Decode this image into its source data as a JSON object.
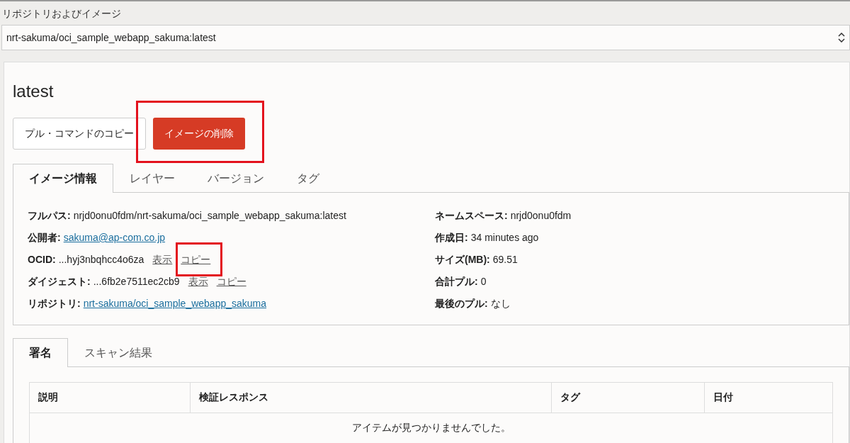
{
  "repo_select": {
    "label": "リポジトリおよびイメージ",
    "value": "nrt-sakuma/oci_sample_webapp_sakuma:latest"
  },
  "title": "latest",
  "actions": [
    {
      "label": "プル・コマンドのコピー",
      "kind": "secondary",
      "highlighted": false
    },
    {
      "label": "イメージの削除",
      "kind": "danger",
      "highlighted": true
    }
  ],
  "tabs": [
    {
      "label": "イメージ情報",
      "selected": true
    },
    {
      "label": "レイヤー",
      "selected": false
    },
    {
      "label": "バージョン",
      "selected": false
    },
    {
      "label": "タグ",
      "selected": false
    }
  ],
  "details_left": [
    {
      "label": "フルパス:",
      "value": "nrjd0onu0fdm/nrt-sakuma/oci_sample_webapp_sakuma:latest",
      "kind": "text"
    },
    {
      "label": "公開者:",
      "value": "sakuma@ap-com.co.jp",
      "kind": "link"
    },
    {
      "label": "OCID:",
      "value": "...hyj3nbqhcc4o6za",
      "kind": "text",
      "actions": [
        {
          "label": "表示",
          "highlighted": false
        },
        {
          "label": "コピー",
          "highlighted": true
        }
      ]
    },
    {
      "label": "ダイジェスト:",
      "value": "...6fb2e7511ec2cb9",
      "kind": "text",
      "actions": [
        {
          "label": "表示",
          "highlighted": false
        },
        {
          "label": "コピー",
          "highlighted": false
        }
      ]
    },
    {
      "label": "リポジトリ:",
      "value": "nrt-sakuma/oci_sample_webapp_sakuma",
      "kind": "link"
    }
  ],
  "details_right": [
    {
      "label": "ネームスペース:",
      "value": "nrjd0onu0fdm"
    },
    {
      "label": "作成日:",
      "value": "34 minutes ago"
    },
    {
      "label": "サイズ(MB):",
      "value": "69.51"
    },
    {
      "label": "合計プル:",
      "value": "0"
    },
    {
      "label": "最後のプル:",
      "value": "なし"
    }
  ],
  "lower_tabs": [
    {
      "label": "署名",
      "selected": true
    },
    {
      "label": "スキャン結果",
      "selected": false
    }
  ],
  "table": {
    "columns": [
      "説明",
      "検証レスポンス",
      "タグ",
      "日付"
    ],
    "empty_message": "アイテムが見つかりませんでした。"
  }
}
